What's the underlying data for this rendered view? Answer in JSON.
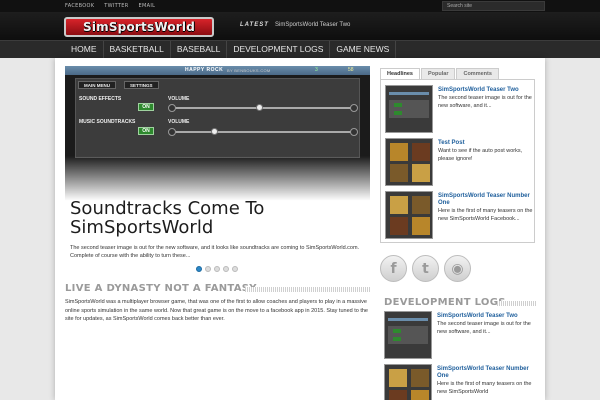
{
  "topbar": {
    "links": [
      "FACEBOOK",
      "TWITTER",
      "EMAIL"
    ],
    "search_placeholder": "Search site"
  },
  "header": {
    "logo_text": "SimSportsWorld",
    "latest_label": "LATEST",
    "latest_text": "SimSportsWorld Teaser Two"
  },
  "nav": {
    "items": [
      "HOME",
      "BASKETBALL",
      "BASEBALL",
      "DEVELOPMENT LOGS",
      "GAME NEWS"
    ]
  },
  "slider": {
    "game_header": "HAPPY ROCK",
    "game_byline": "BY BENBOUKS.COM",
    "stat_a": "3",
    "stat_b": "58",
    "buttons": [
      "MAIN MENU",
      "SETTINGS"
    ],
    "row1_label": "SOUND EFFECTS",
    "row1_toggle": "ON",
    "row1_slider": "VOLUME",
    "row2_label": "MUSIC SOUNDTRACKS",
    "row2_toggle": "ON",
    "row2_slider": "VOLUME",
    "title": "Soundtracks Come To SimSportsWorld",
    "excerpt": "The second teaser image is out for the new software, and it looks like soundtracks are coming to SimSportsWorld.com.  Complete of course with the ability to turn these...",
    "slide_count": 5,
    "active_slide": 1
  },
  "section": {
    "title": "LIVE A DYNASTY NOT A FANTASY",
    "text": "SimSportsWorld was a multiplayer browser game, that was one of the first to allow coaches and players to play in a massive online sports simulation in the same world. Now that great game is on the move to a facebook app in 2015. Stay tuned to the site for updates, as SimSportsWorld comes back better than ever."
  },
  "sidebar": {
    "tabs": [
      "Headlines",
      "Popular",
      "Comments"
    ],
    "active_tab": "Headlines",
    "headlines": [
      {
        "title": "SimSportsWorld Teaser Two",
        "desc": "The second teaser image is out for the new software, and it..."
      },
      {
        "title": "Test Post",
        "desc": "Want to see if the auto post works, please ignore!"
      },
      {
        "title": "SimSportsWorld Teaser Number One",
        "desc": "Here is the first of many teasers on the new SimSportsWorld Facebook..."
      }
    ],
    "social_icons": [
      "facebook-icon",
      "twitter-icon",
      "rss-icon"
    ],
    "social_glyphs": [
      "f",
      "t",
      "◉"
    ],
    "dev_title": "DEVELOPMENT LOGS",
    "dev_logs": [
      {
        "title": "SimSportsWorld Teaser Two",
        "desc": "The second teaser image is out for the new software, and it..."
      },
      {
        "title": "SimSportsWorld Teaser Number One",
        "desc": "Here is the first of many teasers on the new SimSportsWorld"
      }
    ]
  },
  "colors": {
    "accent_blue": "#1f5f9c",
    "dot_active": "#2b87c7",
    "logo_red": "#d8232a",
    "toggle_green": "#2e8a2e"
  }
}
